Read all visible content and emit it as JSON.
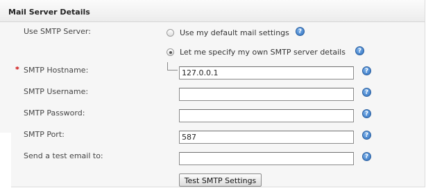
{
  "section": {
    "title": "Mail Server Details"
  },
  "smtp_server": {
    "label": "Use SMTP Server:",
    "options": [
      {
        "label": "Use my default mail settings",
        "selected": false
      },
      {
        "label": "Let me specify my own SMTP server details",
        "selected": true
      }
    ]
  },
  "fields": {
    "hostname": {
      "label": "SMTP Hostname:",
      "required_marker": "*",
      "value": "127.0.0.1"
    },
    "username": {
      "label": "SMTP Username:",
      "value": ""
    },
    "password": {
      "label": "SMTP Password:",
      "value": ""
    },
    "port": {
      "label": "SMTP Port:",
      "value": "587"
    },
    "test_email": {
      "label": "Send a test email to:",
      "value": ""
    }
  },
  "help_icon": {
    "glyph": "?",
    "icon": "help-icon",
    "color": "#2d6fbf"
  },
  "buttons": {
    "test_smtp": "Test SMTP Settings"
  },
  "colors": {
    "required": "#cc0000",
    "panel_background": "#f6f6f6"
  }
}
